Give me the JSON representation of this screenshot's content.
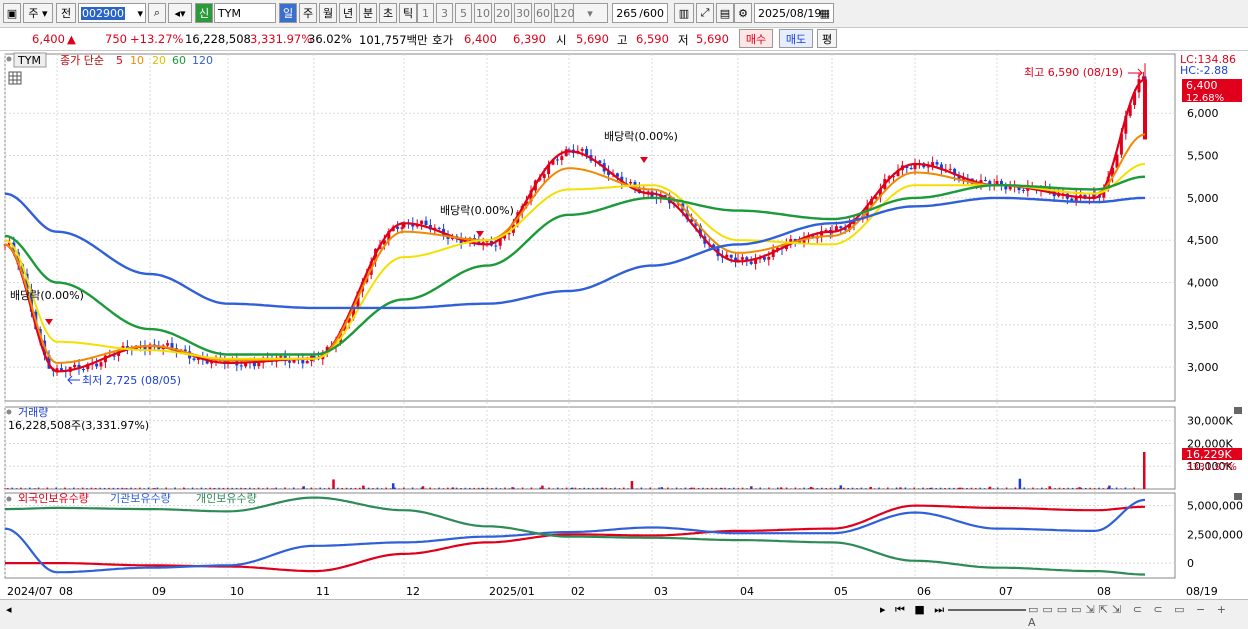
{
  "toolbar": {
    "type_label": "주",
    "period_label": "전",
    "stock_code": "002900",
    "credit_badge": "신",
    "stock_name": "TYM",
    "periods": [
      "일",
      "주",
      "월",
      "년",
      "분",
      "초",
      "틱"
    ],
    "active_period": "일",
    "intervals": [
      "1",
      "3",
      "5",
      "10",
      "20",
      "30",
      "60",
      "120"
    ],
    "count_value": "265",
    "count_total": "/600",
    "date": "2025/08/19"
  },
  "quote": {
    "price": "6,400",
    "arrow": "▲",
    "change": "750",
    "change_pct": "+13.27%",
    "volume": "16,228,508",
    "volume_pct": "3,331.97%",
    "turnover": "36.02%",
    "amount": "101,757백만",
    "bid_label": "호가",
    "bid1": "6,400",
    "bid2": "6,390",
    "open_label": "시",
    "open": "5,690",
    "high_label": "고",
    "high": "6,590",
    "low_label": "저",
    "low": "5,690",
    "buy_label": "매수",
    "sell_label": "매도",
    "avg_label": "평"
  },
  "legend": {
    "ticker": "TYM",
    "ma_title": "종가 단순",
    "ma_periods": [
      "5",
      "10",
      "20",
      "60",
      "120"
    ]
  },
  "annotations": {
    "high": "최고 6,590 (08/19)",
    "low": "최저 2,725 (08/05)",
    "div1": "배당락(0.00%)",
    "div2": "배당락(0.00%)",
    "div3": "배당락(0.00%)"
  },
  "right_labels": {
    "lc": "LC:134.86",
    "hc": "HC:-2.88",
    "last_price": "6,400",
    "last_pct": "12.68%",
    "vol_last": "16,229K",
    "vol_pct": "3331.97%"
  },
  "volume_panel": {
    "title": "거래량",
    "value_line": "16,228,508주(3,331.97%)"
  },
  "holding_panel": {
    "foreign": "외국인보유수량",
    "inst": "기관보유수량",
    "indiv": "개인보유수량"
  },
  "x_labels": [
    "2024/07",
    "08",
    "09",
    "10",
    "11",
    "12",
    "2025/01",
    "02",
    "03",
    "04",
    "05",
    "06",
    "07",
    "08"
  ],
  "x_right": "08/19",
  "colors": {
    "up": "#e0001b",
    "down": "#1a3fd6",
    "ma5": "#e0001b",
    "ma10": "#f08a00",
    "ma20": "#f4e000",
    "ma60": "#1b9a3a",
    "ma120": "#3060d8",
    "foreign": "#e0001b",
    "inst": "#3060d8",
    "indiv": "#2e8b57"
  },
  "chart_data": [
    {
      "type": "line",
      "title": "TYM",
      "y_ticks": [
        3000,
        3500,
        4000,
        4500,
        5000,
        5500,
        6000
      ],
      "ylim": [
        2600,
        6700
      ],
      "x": [
        "2024/07",
        "08",
        "09",
        "10",
        "11",
        "12",
        "2025/01",
        "02",
        "03",
        "04",
        "05",
        "06",
        "07",
        "08",
        "08/19"
      ],
      "series": [
        {
          "name": "5",
          "values": [
            4450,
            2950,
            3250,
            3050,
            3100,
            4700,
            4450,
            5550,
            5050,
            4250,
            4600,
            5400,
            5150,
            5000,
            6400
          ]
        },
        {
          "name": "10",
          "values": [
            4450,
            3050,
            3250,
            3080,
            3100,
            4600,
            4500,
            5350,
            5100,
            4350,
            4550,
            5300,
            5150,
            5050,
            5750
          ]
        },
        {
          "name": "20",
          "values": [
            4500,
            3300,
            3200,
            3100,
            3100,
            4300,
            4500,
            5100,
            5150,
            4500,
            4450,
            5150,
            5150,
            5050,
            5400
          ]
        },
        {
          "name": "60",
          "values": [
            4550,
            4000,
            3450,
            3150,
            3150,
            3800,
            4200,
            4800,
            5000,
            4850,
            4750,
            5000,
            5150,
            5100,
            5250
          ]
        },
        {
          "name": "120",
          "values": [
            5050,
            4600,
            4100,
            3750,
            3700,
            3700,
            3750,
            3900,
            4200,
            4450,
            4700,
            4900,
            5000,
            4950,
            5000
          ]
        }
      ],
      "annotations": [
        {
          "text": "최고 6,590 (08/19)",
          "y": 6590
        },
        {
          "text": "최저 2,725 (08/05)",
          "y": 2725
        }
      ]
    },
    {
      "type": "bar",
      "title": "거래량",
      "y_ticks": [
        10000,
        20000,
        30000
      ],
      "y_unit": "K",
      "ylim": [
        0,
        36000
      ],
      "values_k": [
        200,
        300,
        250,
        200,
        250,
        400,
        350,
        300,
        200,
        250,
        1200,
        4200,
        1500,
        2500,
        1200,
        700,
        500,
        800,
        1500,
        600,
        600,
        3500,
        800,
        600,
        500,
        1200,
        700,
        900,
        1600,
        900,
        700,
        500,
        600,
        1000,
        4500,
        1200,
        800,
        1500,
        16229
      ],
      "last_value_k": 16229
    },
    {
      "type": "line",
      "title": "보유수량",
      "y_ticks": [
        0,
        2500000,
        5000000
      ],
      "ylim": [
        -1300000,
        6100000
      ],
      "x": [
        "2024/07",
        "08",
        "09",
        "10",
        "11",
        "12",
        "2025/01",
        "02",
        "03",
        "04",
        "05",
        "06",
        "07",
        "08",
        "08/19"
      ],
      "series": [
        {
          "name": "외국인보유수량",
          "values": [
            0,
            0,
            -200000,
            -300000,
            -700000,
            800000,
            1800000,
            2500000,
            2400000,
            2800000,
            3000000,
            5000000,
            4800000,
            4600000,
            4900000
          ]
        },
        {
          "name": "기관보유수량",
          "values": [
            3000000,
            -800000,
            -400000,
            -200000,
            1500000,
            1800000,
            2300000,
            2700000,
            3100000,
            2600000,
            2600000,
            4400000,
            3000000,
            2800000,
            5500000
          ]
        },
        {
          "name": "개인보유수량",
          "values": [
            4700000,
            4800000,
            4700000,
            4500000,
            5700000,
            4600000,
            3200000,
            2300000,
            2200000,
            2000000,
            1800000,
            200000,
            -400000,
            -700000,
            -1000000
          ]
        }
      ]
    }
  ]
}
